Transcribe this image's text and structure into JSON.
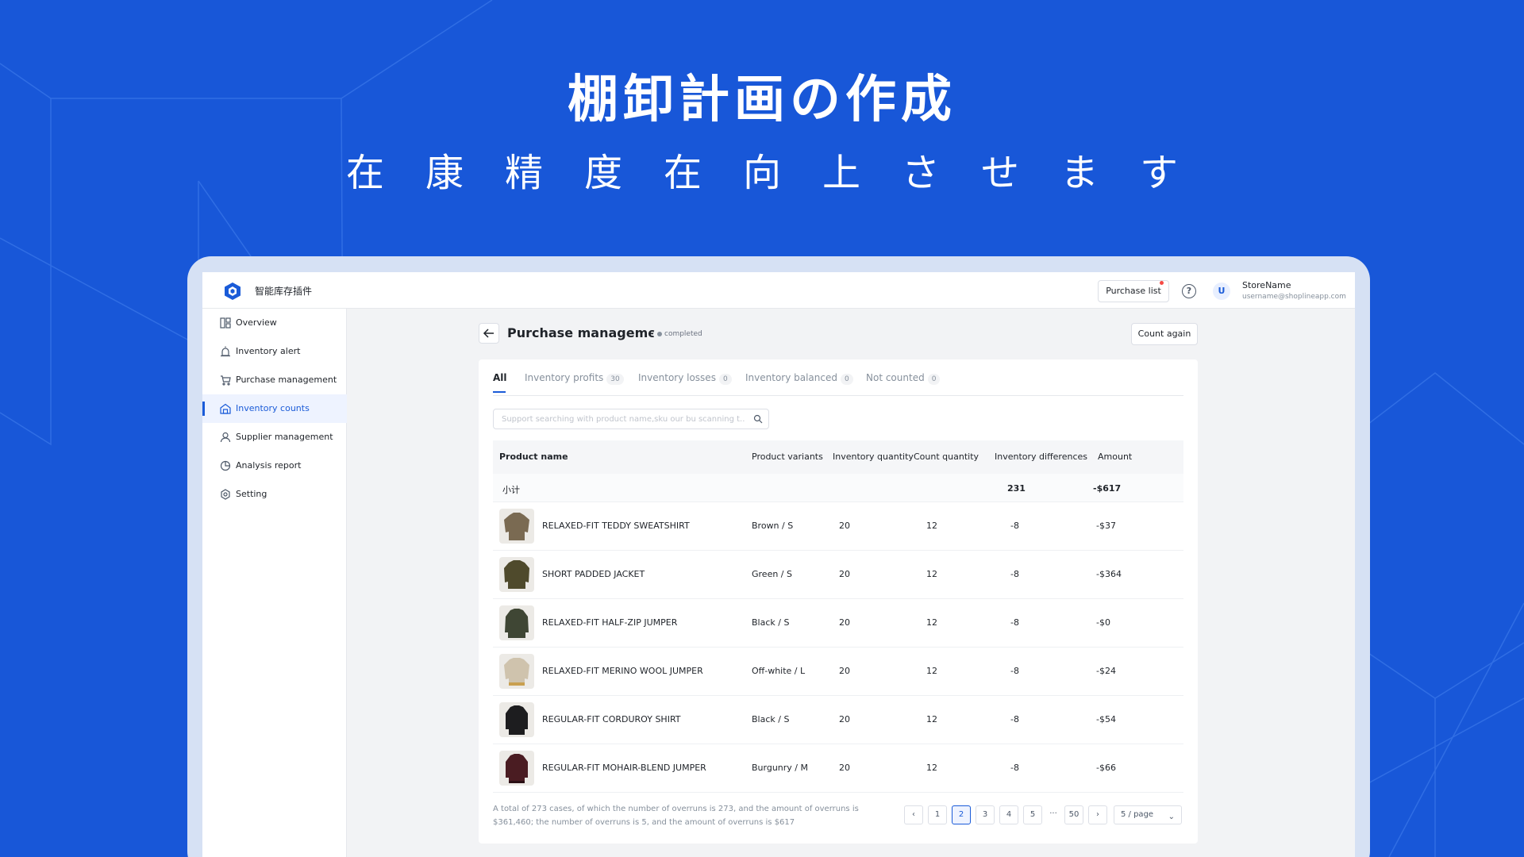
{
  "hero": {
    "title": "棚卸計画の作成",
    "subtitle": "在康精度在向上させます"
  },
  "topbar": {
    "app_name": "智能库存插件",
    "purchase_list_label": "Purchase list",
    "help_icon": "question-circle-icon",
    "avatar_letter": "U",
    "store_name": "StoreName",
    "store_email": "username@shoplineapp.com"
  },
  "sidebar": {
    "items": [
      {
        "label": "Overview",
        "icon": "dashboard-icon"
      },
      {
        "label": "Inventory alert",
        "icon": "alarm-icon"
      },
      {
        "label": "Purchase management",
        "icon": "cart-icon"
      },
      {
        "label": "Inventory counts",
        "icon": "warehouse-icon",
        "active": true
      },
      {
        "label": "Supplier management",
        "icon": "user-icon"
      },
      {
        "label": "Analysis report",
        "icon": "pie-chart-icon"
      },
      {
        "label": "Setting",
        "icon": "gear-icon"
      }
    ]
  },
  "page": {
    "title": "Purchase management",
    "status": "completed",
    "count_again_label": "Count again"
  },
  "tabs": [
    {
      "label": "All",
      "count": ""
    },
    {
      "label": "Inventory profits",
      "count": "30"
    },
    {
      "label": "Inventory losses",
      "count": "0"
    },
    {
      "label": "Inventory balanced",
      "count": "0"
    },
    {
      "label": "Not counted",
      "count": "0"
    }
  ],
  "search": {
    "placeholder": "Support searching with product name,sku our bu scanning t..."
  },
  "table": {
    "headers": [
      "Product name",
      "Product variants",
      "Inventory quantity",
      "Count quantity",
      "Inventory differences",
      "Amount"
    ],
    "subtotal": {
      "label": "小计",
      "differences": "231",
      "amount": "-$617"
    },
    "rows": [
      {
        "name": "RELAXED-FIT TEDDY SWEATSHIRT",
        "variant": "Brown / S",
        "inv_qty": "20",
        "count_qty": "12",
        "diff": "-8",
        "amount": "-$37",
        "thumb_color": "#7a6a52"
      },
      {
        "name": "SHORT PADDED JACKET",
        "variant": "Green / S",
        "inv_qty": "20",
        "count_qty": "12",
        "diff": "-8",
        "amount": "-$364",
        "thumb_color": "#4f4a2c"
      },
      {
        "name": "RELAXED-FIT HALF-ZIP JUMPER",
        "variant": "Black / S",
        "inv_qty": "20",
        "count_qty": "12",
        "diff": "-8",
        "amount": "-$0",
        "thumb_color": "#3f4634"
      },
      {
        "name": "RELAXED-FIT MERINO WOOL JUMPER",
        "variant": "Off-white / L",
        "inv_qty": "20",
        "count_qty": "12",
        "diff": "-8",
        "amount": "-$24",
        "thumb_color": "#cfc3ad"
      },
      {
        "name": "REGULAR-FIT CORDUROY SHIRT",
        "variant": "Black / S",
        "inv_qty": "20",
        "count_qty": "12",
        "diff": "-8",
        "amount": "-$54",
        "thumb_color": "#1d1d1f"
      },
      {
        "name": "REGULAR-FIT MOHAIR-BLEND JUMPER",
        "variant": "Burgunry / M",
        "inv_qty": "20",
        "count_qty": "12",
        "diff": "-8",
        "amount": "-$66",
        "thumb_color": "#4a1c22"
      }
    ]
  },
  "footer": {
    "summary_line1": "A total of 273 cases, of which the number of overruns is 273, and the amount of overruns is",
    "summary_line2": "$361,460; the number of overruns is 5, and the amount of overruns is $617"
  },
  "pagination": {
    "prev": "‹",
    "pages": [
      "1",
      "2",
      "3",
      "4",
      "5"
    ],
    "current": "2",
    "ellipsis": "···",
    "last": "50",
    "next": "›",
    "page_size": "5 / page"
  },
  "colors": {
    "background": "#1857d8",
    "accent": "#1a5bd8"
  }
}
